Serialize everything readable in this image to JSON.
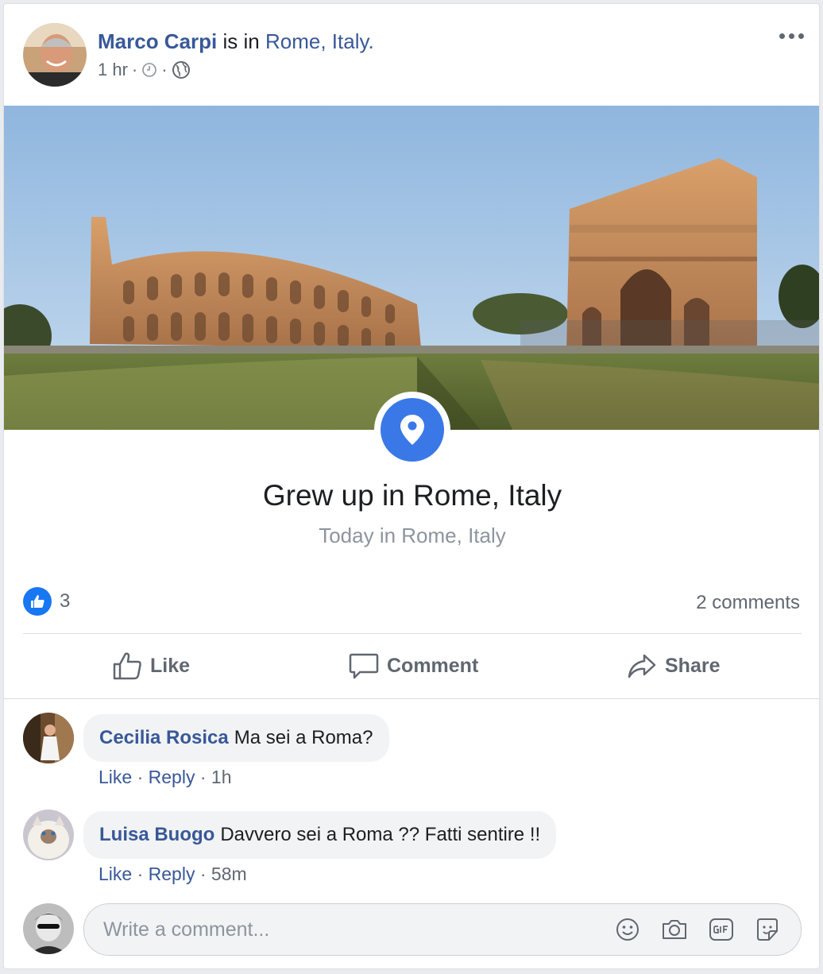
{
  "post": {
    "author": "Marco Carpi",
    "verb": "is in",
    "location": "Rome, Italy.",
    "time": "1 hr",
    "separator": "·"
  },
  "place": {
    "title": "Grew up in Rome, Italy",
    "subtitle": "Today in Rome, Italy"
  },
  "stats": {
    "likes": "3",
    "comments": "2 comments"
  },
  "actions": {
    "like": "Like",
    "comment": "Comment",
    "share": "Share"
  },
  "comments": [
    {
      "author": "Cecilia Rosica",
      "text": "Ma sei a Roma?",
      "like": "Like",
      "reply": "Reply",
      "time": "1h"
    },
    {
      "author": "Luisa Buogo",
      "text": "Davvero sei a Roma ?? Fatti sentire !!",
      "like": "Like",
      "reply": "Reply",
      "time": "58m"
    }
  ],
  "composer": {
    "placeholder": "Write a comment..."
  },
  "icons": {
    "more": "more-options-icon",
    "clock": "clock-icon",
    "globe": "globe-icon",
    "pin": "map-pin-icon",
    "thumb": "thumbs-up-icon",
    "emoji": "emoji-icon",
    "camera": "camera-icon",
    "gif": "gif-icon",
    "sticker": "sticker-icon"
  },
  "colors": {
    "link": "#385898",
    "like_blue": "#1877f2",
    "pin_blue": "#3b78e7",
    "muted": "#606770"
  }
}
